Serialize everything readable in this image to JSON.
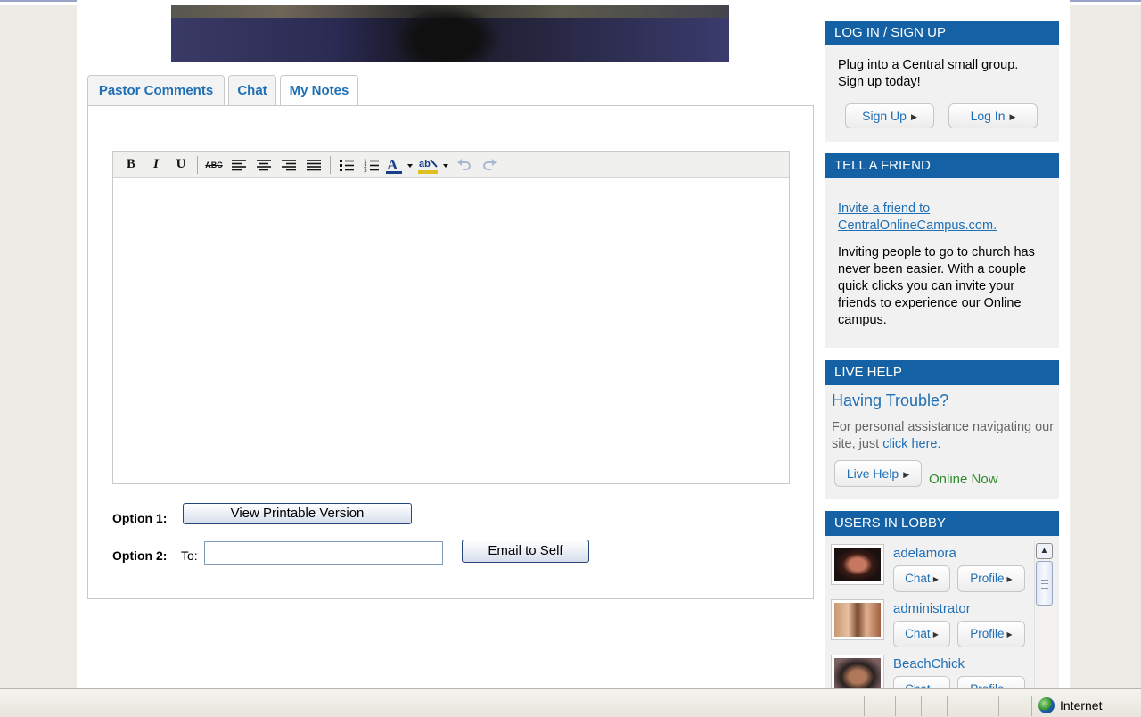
{
  "tabs": [
    {
      "label": "Pastor Comments",
      "active": false
    },
    {
      "label": "Chat",
      "active": false
    },
    {
      "label": "My Notes",
      "active": true
    }
  ],
  "editor": {
    "toolbar": [
      "bold",
      "italic",
      "underline",
      "strikethrough",
      "align-left",
      "align-center",
      "align-right",
      "align-justify",
      "bullet-list",
      "numbered-list",
      "text-color",
      "highlight-color",
      "undo",
      "redo"
    ],
    "content": ""
  },
  "options": {
    "option1_label": "Option 1:",
    "printable_label": "View Printable Version",
    "option2_label": "Option 2:",
    "to_label": "To:",
    "to_value": "",
    "email_label": "Email to Self"
  },
  "sidebar": {
    "login": {
      "title": "LOG IN / SIGN UP",
      "text": "Plug into a Central small group. Sign up today!",
      "signup_label": "Sign Up",
      "login_label": "Log In"
    },
    "tell_friend": {
      "title": "TELL A FRIEND",
      "link_text": "Invite a friend to CentralOnlineCampus.com.",
      "text": "Inviting people to go to church has never been easier. With a couple quick clicks you can invite your friends to experience our Online campus."
    },
    "live_help": {
      "title": "LIVE HELP",
      "heading": "Having Trouble?",
      "text": "For personal assistance navigating our site, just ",
      "link_text": "click here.",
      "button_label": "Live Help",
      "status": "Online Now"
    },
    "lobby": {
      "title": "USERS IN LOBBY",
      "chat_label": "Chat",
      "profile_label": "Profile",
      "users": [
        {
          "name": "adelamora"
        },
        {
          "name": "administrator"
        },
        {
          "name": "BeachChick"
        }
      ]
    }
  },
  "statusbar": {
    "zone": "Internet"
  },
  "colors": {
    "accent": "#1561a5",
    "link": "#1f6fb5",
    "online": "#2e8b2e"
  }
}
